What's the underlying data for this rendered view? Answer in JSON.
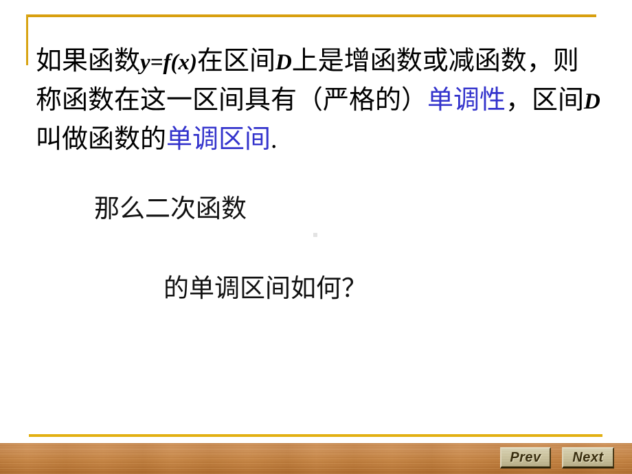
{
  "slide": {
    "definition": {
      "line1_a": "如果函数",
      "line1_math": "y=f(x)",
      "line1_b": "在区间",
      "line1_var": "D",
      "line1_c": "上是增函数或减函数，则",
      "line2_a": "称函数在这一区间具有（严格的）",
      "line2_hl": "单调性",
      "line2_b": "，区间",
      "line2_var": "D",
      "line3_a": "叫做函数的",
      "line3_hl": "单调区间",
      "line3_b": "."
    },
    "question": {
      "line1": "那么二次函数",
      "line2": "的单调区间如何？"
    }
  },
  "footer": {
    "prev_label": "Prev",
    "next_label": "Next"
  },
  "colors": {
    "gold_rule": "#d89f0e",
    "highlight_blue": "#3333cc",
    "wood": "#c4813f",
    "button_face": "#cfc7a4",
    "button_text": "#3a2f10"
  }
}
